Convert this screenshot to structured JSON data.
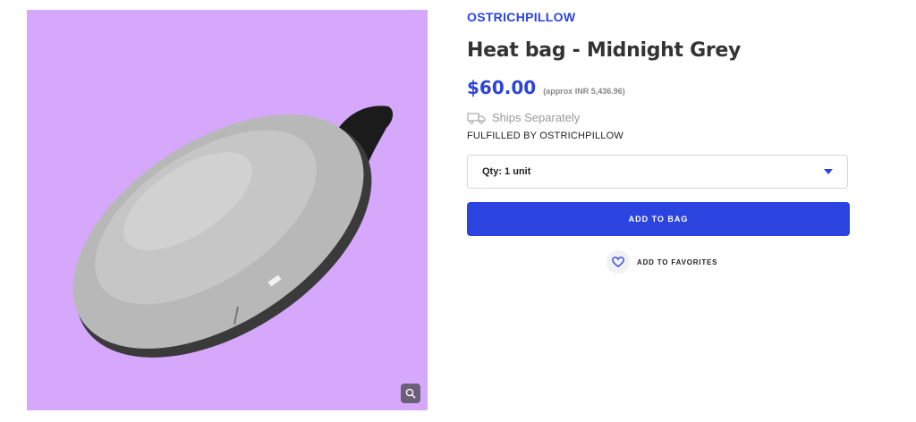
{
  "product": {
    "brand": "OSTRICHPILLOW",
    "title": "Heat bag - Midnight Grey",
    "price": "$60.00",
    "price_approx": "(approx INR 5,436.96)",
    "shipping": "Ships Separately",
    "fulfilled_by": "FULFILLED BY OSTRICHPILLOW",
    "image_background": "#d5a8fb"
  },
  "quantity": {
    "selected": "Qty: 1 unit"
  },
  "actions": {
    "add_to_bag": "ADD TO BAG",
    "add_to_favorites": "ADD TO FAVORITES"
  },
  "icons": {
    "zoom": "search-icon",
    "shipping": "truck-icon",
    "caret": "caret-down-icon",
    "favorite": "heart-icon"
  },
  "colors": {
    "accent": "#2b44e0"
  }
}
